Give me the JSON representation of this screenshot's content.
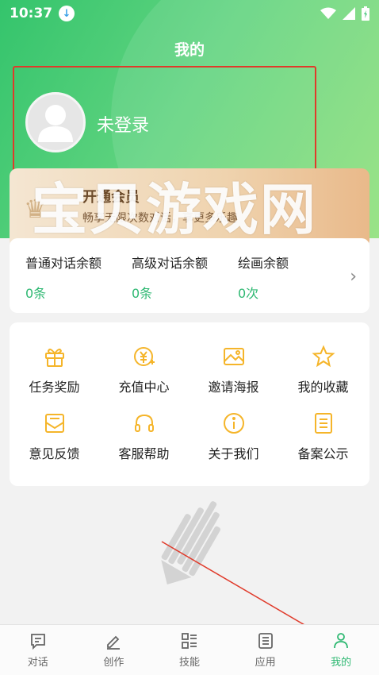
{
  "status_bar": {
    "time": "10:37"
  },
  "page_title": "我的",
  "profile": {
    "login_text": "未登录"
  },
  "vip": {
    "title": "开通会员",
    "subtitle": "畅享无限次数对话，享更多乐趣"
  },
  "watermark": "宝贝游戏网",
  "balances": [
    {
      "label": "普通对话余额",
      "value": "0条"
    },
    {
      "label": "高级对话余额",
      "value": "0条"
    },
    {
      "label": "绘画余额",
      "value": "0次"
    }
  ],
  "menu": [
    {
      "label": "任务奖励",
      "icon": "gift-icon"
    },
    {
      "label": "充值中心",
      "icon": "recharge-icon"
    },
    {
      "label": "邀请海报",
      "icon": "image-icon"
    },
    {
      "label": "我的收藏",
      "icon": "star-icon"
    },
    {
      "label": "意见反馈",
      "icon": "mail-icon"
    },
    {
      "label": "客服帮助",
      "icon": "headset-icon"
    },
    {
      "label": "关于我们",
      "icon": "info-icon"
    },
    {
      "label": "备案公示",
      "icon": "list-icon"
    }
  ],
  "tabs": [
    {
      "label": "对话",
      "icon": "chat-icon"
    },
    {
      "label": "创作",
      "icon": "edit-icon"
    },
    {
      "label": "技能",
      "icon": "grid-icon"
    },
    {
      "label": "应用",
      "icon": "doc-icon"
    },
    {
      "label": "我的",
      "icon": "person-icon"
    }
  ],
  "colors": {
    "accent": "#2eb872",
    "menu_icon": "#f5b52a",
    "annotation": "#e03a2a"
  }
}
